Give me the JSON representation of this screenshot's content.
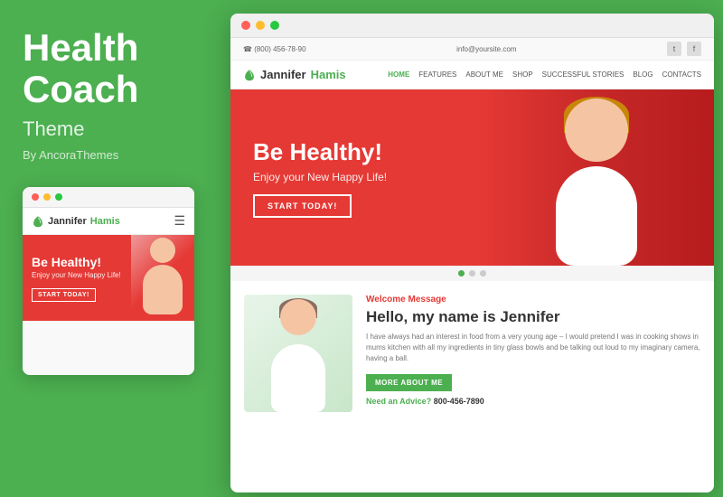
{
  "left": {
    "title_line1": "Health",
    "title_line2": "Coach",
    "subtitle": "Theme",
    "by": "By AncoraThemes"
  },
  "mobile": {
    "logo_name": "Jannifer",
    "logo_surname": "Hamis",
    "hero_heading": "Be Healthy!",
    "hero_sub": "Enjoy your New Happy Life!",
    "btn": "START TODAY!"
  },
  "desktop": {
    "topbar_phone": "☎ (800) 456-78-90",
    "topbar_email": "info@yoursite.com",
    "logo_name": "Jannifer",
    "logo_surname": "Hamis",
    "nav": [
      "HOME",
      "FEATURES",
      "ABOUT ME",
      "SHOP",
      "SUCCESSFUL STORIES",
      "BLOG",
      "CONTACTS"
    ],
    "hero_heading": "Be Healthy!",
    "hero_sub": "Enjoy your New Happy Life!",
    "hero_btn": "START TODAY!",
    "welcome_label": "Welcome Message",
    "jennifer_heading": "Hello, my name is Jennifer",
    "jennifer_body": "I have always had an interest in food from a very young age – I would pretend I was in cooking shows in mums kitchen with all my ingredients in tiny glass bowls and be talking out loud to my imaginary camera, having a ball.",
    "more_btn": "MORE ABOUT ME",
    "advice_label": "Need an Advice?",
    "phone": "800-456-7890"
  }
}
